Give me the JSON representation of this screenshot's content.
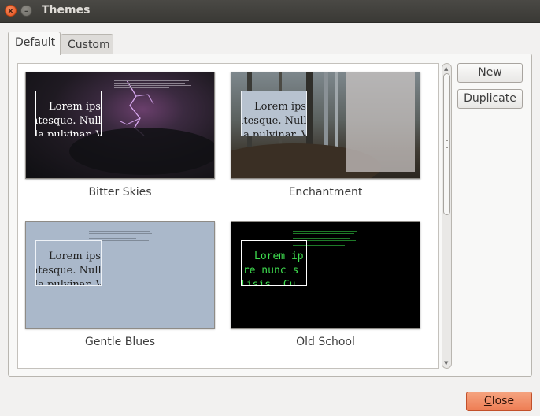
{
  "window": {
    "title": "Themes",
    "close_glyph": "×",
    "minimize_glyph": "–"
  },
  "tabs": [
    {
      "label": "Default",
      "active": true
    },
    {
      "label": "Custom",
      "active": false
    }
  ],
  "themes": [
    {
      "name": "Bitter Skies",
      "sample_lines": [
        "Lorem ipsu",
        "ntesque. Nulla",
        "la pulvinar. V"
      ],
      "colors": {
        "bg_top": "#2a1f2e",
        "bg_bottom": "#111013",
        "text": "#ffffff",
        "box_border": "#ffffff",
        "lightning": "#d9a9f0"
      }
    },
    {
      "name": "Enchantment",
      "sample_lines": [
        "Lorem ipsu",
        "ntesque. Nulla",
        "la pulvinar. V"
      ],
      "colors": {
        "bg_top": "#6f7a80",
        "bg_bottom": "#3b3630",
        "text": "#1f1f1f",
        "box_bg": "#b7c2cf",
        "box_border": "#eef1f5",
        "panel": "#c9c4c3"
      }
    },
    {
      "name": "Gentle Blues",
      "sample_lines": [
        "Lorem ipsu",
        "ntesque. Nulla",
        "la pulvinar. V"
      ],
      "colors": {
        "bg": "#aab8ca",
        "text": "#222222",
        "box_border": "#eef2f7"
      }
    },
    {
      "name": "Old School",
      "sample_lines": [
        "Lorem ip",
        "are nunc s",
        "lisis. Cu"
      ],
      "colors": {
        "bg": "#000000",
        "text": "#3fdd4f",
        "box_border": "#ffffff"
      }
    }
  ],
  "buttons": {
    "new": "New",
    "duplicate": "Duplicate",
    "close_mnemonic": "C",
    "close_rest": "lose"
  },
  "scrollbar": {
    "up_glyph": "▲",
    "down_glyph": "▼"
  }
}
